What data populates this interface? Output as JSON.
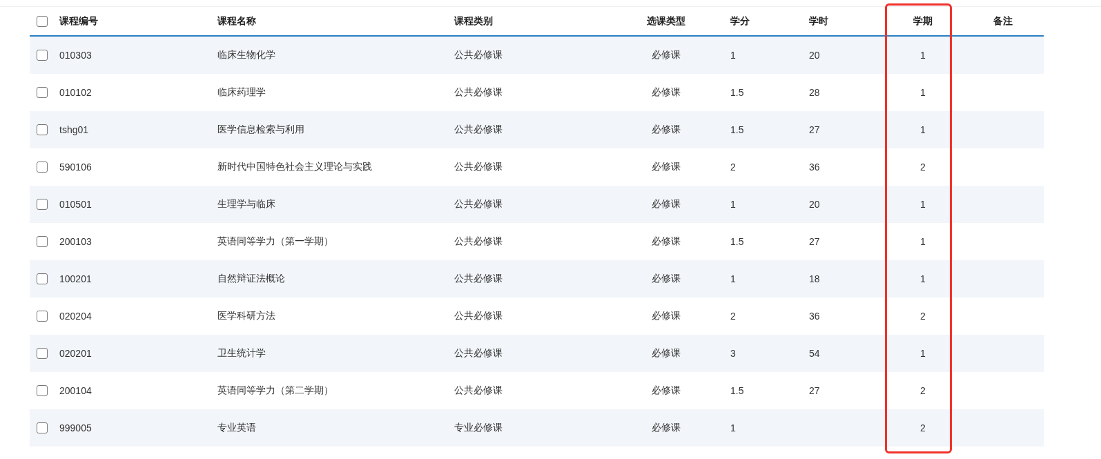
{
  "table": {
    "select_all": {
      "checked": false
    },
    "columns": [
      {
        "label": "课程编号",
        "highlighted": false
      },
      {
        "label": "课程名称",
        "highlighted": false
      },
      {
        "label": "课程类别",
        "highlighted": false
      },
      {
        "label": "选课类型",
        "highlighted": false
      },
      {
        "label": "学分",
        "highlighted": false
      },
      {
        "label": "学时",
        "highlighted": false
      },
      {
        "label": "学期",
        "highlighted": true
      },
      {
        "label": "备注",
        "highlighted": false
      }
    ],
    "rows": [
      {
        "checked": false,
        "cells": [
          "010303",
          "临床生物化学",
          "公共必修课",
          "必修课",
          "1",
          "20",
          "1"
        ]
      },
      {
        "checked": false,
        "cells": [
          "010102",
          "临床药理学",
          "公共必修课",
          "必修课",
          "1.5",
          "28",
          "1"
        ]
      },
      {
        "checked": false,
        "cells": [
          "tshg01",
          "医学信息检索与利用",
          "公共必修课",
          "必修课",
          "1.5",
          "27",
          "1"
        ]
      },
      {
        "checked": false,
        "cells": [
          "590106",
          "新时代中国特色社会主义理论与实践",
          "公共必修课",
          "必修课",
          "2",
          "36",
          "2"
        ]
      },
      {
        "checked": false,
        "cells": [
          "010501",
          "生理学与临床",
          "公共必修课",
          "必修课",
          "1",
          "20",
          "1"
        ]
      },
      {
        "checked": false,
        "cells": [
          "200103",
          "英语同等学力（第一学期）",
          "公共必修课",
          "必修课",
          "1.5",
          "27",
          "1"
        ]
      },
      {
        "checked": false,
        "cells": [
          "100201",
          "自然辩证法概论",
          "公共必修课",
          "必修课",
          "1",
          "18",
          "1"
        ]
      },
      {
        "checked": false,
        "cells": [
          "020204",
          "医学科研方法",
          "公共必修课",
          "必修课",
          "2",
          "36",
          "2"
        ]
      },
      {
        "checked": false,
        "cells": [
          "020201",
          "卫生统计学",
          "公共必修课",
          "必修课",
          "3",
          "54",
          "1"
        ]
      },
      {
        "checked": false,
        "cells": [
          "200104",
          "英语同等学力（第二学期）",
          "公共必修课",
          "必修课",
          "1.5",
          "27",
          "2"
        ]
      },
      {
        "checked": false,
        "cells": [
          "999005",
          "专业英语",
          "专业必修课",
          "必修课",
          "1",
          null,
          "2"
        ]
      }
    ]
  }
}
